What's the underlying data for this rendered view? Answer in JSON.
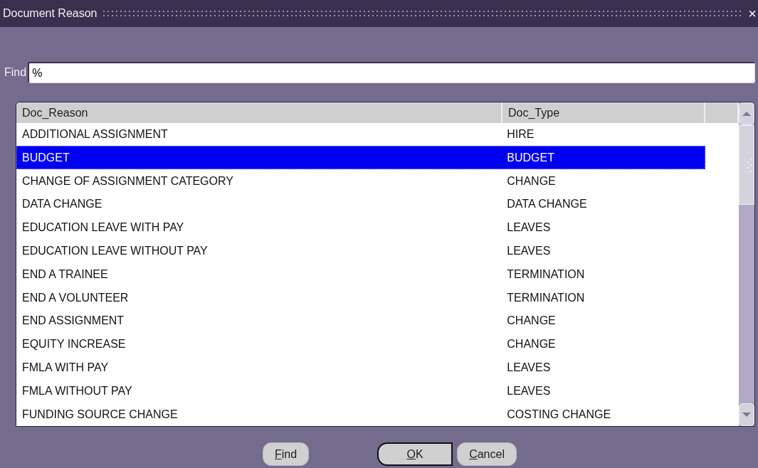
{
  "window": {
    "title": "Document Reason",
    "close": "×"
  },
  "find": {
    "label": "Find",
    "value": "%"
  },
  "table": {
    "columns": [
      "Doc_Reason",
      "Doc_Type"
    ],
    "rows": [
      {
        "cells": [
          "ADDITIONAL ASSIGNMENT",
          "HIRE"
        ],
        "selected": false
      },
      {
        "cells": [
          "BUDGET",
          "BUDGET"
        ],
        "selected": true
      },
      {
        "cells": [
          "CHANGE OF ASSIGNMENT CATEGORY",
          "CHANGE"
        ],
        "selected": false
      },
      {
        "cells": [
          "DATA CHANGE",
          "DATA CHANGE"
        ],
        "selected": false
      },
      {
        "cells": [
          "EDUCATION LEAVE WITH PAY",
          "LEAVES"
        ],
        "selected": false
      },
      {
        "cells": [
          "EDUCATION LEAVE WITHOUT PAY",
          "LEAVES"
        ],
        "selected": false
      },
      {
        "cells": [
          "END A TRAINEE",
          "TERMINATION"
        ],
        "selected": false
      },
      {
        "cells": [
          "END A VOLUNTEER",
          "TERMINATION"
        ],
        "selected": false
      },
      {
        "cells": [
          "END ASSIGNMENT",
          "CHANGE"
        ],
        "selected": false
      },
      {
        "cells": [
          "EQUITY INCREASE",
          "CHANGE"
        ],
        "selected": false
      },
      {
        "cells": [
          "FMLA WITH PAY",
          "LEAVES"
        ],
        "selected": false
      },
      {
        "cells": [
          "FMLA WITHOUT PAY",
          "LEAVES"
        ],
        "selected": false
      },
      {
        "cells": [
          "FUNDING SOURCE CHANGE",
          "COSTING CHANGE"
        ],
        "selected": false
      }
    ]
  },
  "buttons": [
    {
      "label": "Find",
      "kind": "normal"
    },
    {
      "label": "OK",
      "kind": "default"
    },
    {
      "label": "Cancel",
      "kind": "normal"
    }
  ]
}
